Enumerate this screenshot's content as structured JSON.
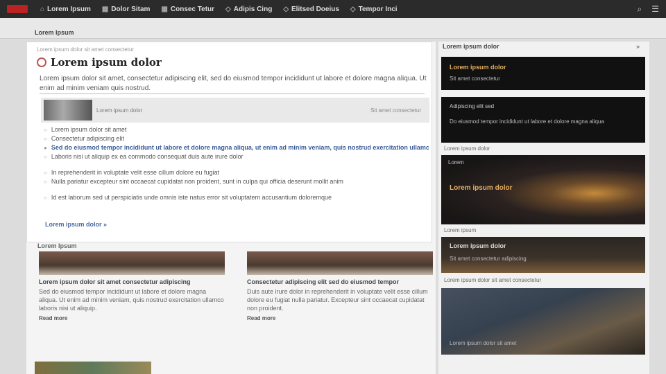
{
  "nav": {
    "items": [
      {
        "label": "Lorem Ipsum",
        "icon": "home-icon"
      },
      {
        "label": "Dolor Sitam",
        "icon": "grid-icon"
      },
      {
        "label": "Consec Tetur",
        "icon": "grid-icon"
      },
      {
        "label": "Adipis Cing",
        "icon": "tag-icon"
      },
      {
        "label": "Elitsed Doeius",
        "icon": "tag-icon"
      },
      {
        "label": "Tempor Inci",
        "icon": "tag-icon"
      }
    ],
    "right_icons": [
      "search-icon",
      "menu-icon"
    ]
  },
  "subbar": {
    "title": "Lorem Ipsum"
  },
  "article": {
    "breadcrumb": "Lorem ipsum dolor sit amet consectetur",
    "headline": "Lorem ipsum dolor",
    "subhead": "Lorem ipsum dolor sit amet, consectetur adipiscing elit, sed do eiusmod tempor incididunt ut labore et dolore magna aliqua. Ut enim ad minim veniam quis nostrud.",
    "media": {
      "caption": "Lorem ipsum dolor",
      "right": "Sit amet consectetur"
    },
    "lines": [
      {
        "text": "Lorem ipsum dolor sit amet",
        "kind": "normal"
      },
      {
        "text": "Consectetur adipiscing elit",
        "kind": "normal"
      },
      {
        "text": "Sed do eiusmod tempor incididunt ut labore et dolore magna aliqua, ut enim ad minim veniam, quis nostrud exercitation ullamco",
        "kind": "link"
      },
      {
        "text": "Laboris nisi ut aliquip ex ea commodo consequat duis aute irure dolor",
        "kind": "normal"
      },
      {
        "text": "In reprehenderit in voluptate velit esse cillum dolore eu fugiat",
        "kind": "normal"
      },
      {
        "text": "Nulla pariatur excepteur sint occaecat cupidatat non proident, sunt in culpa qui officia deserunt mollit anim",
        "kind": "normal"
      },
      {
        "text": "Id est laborum sed ut perspiciatis unde omnis iste natus error sit voluptatem accusantium doloremque",
        "kind": "normal"
      }
    ],
    "more_link": "Lorem ipsum dolor »"
  },
  "more_section": {
    "label": "Lorem Ipsum",
    "stories": [
      {
        "title": "Lorem ipsum dolor sit amet consectetur adipiscing",
        "desc": "Sed do eiusmod tempor incididunt ut labore et dolore magna aliqua. Ut enim ad minim veniam, quis nostrud exercitation ullamco laboris nisi ut aliquip.",
        "read": "Read more"
      },
      {
        "title": "Consectetur adipiscing elit sed do eiusmod tempor",
        "desc": "Duis aute irure dolor in reprehenderit in voluptate velit esse cillum dolore eu fugiat nulla pariatur. Excepteur sint occaecat cupidatat non proident.",
        "read": "Read more"
      }
    ]
  },
  "sidebar": {
    "title": "Lorem ipsum dolor",
    "more": "»",
    "cards": [
      {
        "title": "Lorem ipsum dolor",
        "text": "Sit amet consectetur"
      },
      {
        "title": "Adipiscing elit sed",
        "text": "Do eiusmod tempor incididunt ut labore et dolore magna aliqua"
      }
    ],
    "caption1": "Lorem ipsum dolor",
    "feature": {
      "tag": "Lorem",
      "title": "Lorem ipsum dolor"
    },
    "caption2": "Lorem ipsum",
    "card3": {
      "title": "Lorem ipsum dolor",
      "text": "Sit amet consectetur adipiscing"
    },
    "caption3": "Lorem ipsum dolor sit amet consectetur",
    "card4": {
      "text": "Lorem ipsum dolor sit amet"
    }
  },
  "colors": {
    "accent": "#e8b060",
    "link": "#3a5d99",
    "nav_bg": "#2b2b2b"
  }
}
